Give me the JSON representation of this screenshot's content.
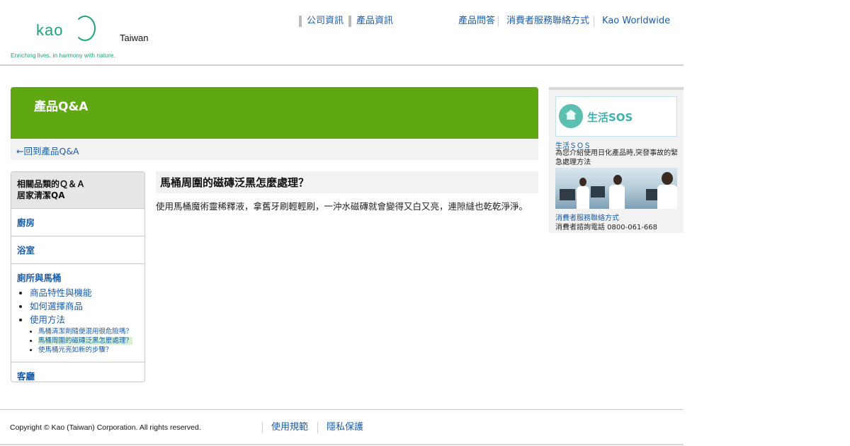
{
  "header": {
    "logo_text": "kao",
    "logo_tagline": "Enriching lives, in harmony with nature.",
    "region": "Taiwan",
    "nav_primary": [
      "公司資訊",
      "產品資訊"
    ],
    "nav_secondary": [
      "產品問答",
      "消費者服務聯絡方式",
      "Kao Worldwide"
    ]
  },
  "banner": {
    "title": "產品Q&A",
    "back_link": "←回到產品Q&A"
  },
  "sidenav": {
    "heading_line1": "相關品類的Ｑ＆Ａ",
    "heading_line2": "居家清潔QA",
    "sections": [
      "廚房",
      "浴室",
      "廁所與馬桶",
      "客廳"
    ],
    "subitems": [
      "商品特性與機能",
      "如何選擇商品",
      "使用方法"
    ],
    "usage_items": [
      "馬桶清潔劑隨便混用很危險嗎？",
      "馬桶周圍的磁磚泛黑怎麼處理？",
      "使馬桶光亮如新的步驟？"
    ]
  },
  "main": {
    "question": "馬桶周圍的磁磚泛黑怎麼處理？",
    "answer": "使用馬桶魔術靈稀釋液，拿舊牙刷輕輕刷，一沖水磁磚就會變得又白又亮，連隙縫也乾乾淨淨。"
  },
  "right_sidebar": {
    "sos_banner_text": "生活SOS",
    "sos_link": "生活ＳＯＳ",
    "sos_desc": "為您介紹使用日化產品時,突發事故的緊急處理方法",
    "contact_link": "消費者服務聯絡方式",
    "contact_desc": "消費者諮詢電話 0800-061-668"
  },
  "footer": {
    "copyright": "Copyright © Kao (Taiwan) Corporation. All rights reserved.",
    "links": [
      "使用規範",
      "隱私保護"
    ]
  }
}
